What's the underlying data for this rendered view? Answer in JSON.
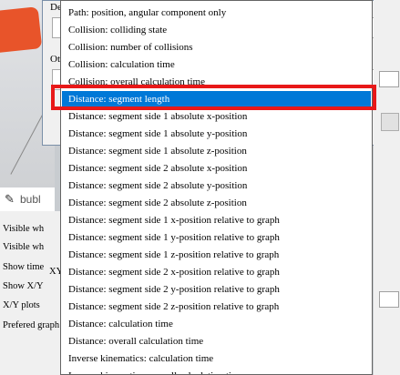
{
  "background": {
    "dialog_label_top": "De",
    "dialog_label_mid": "Ot",
    "bubble_title": "bubl",
    "props_rows": [
      "Visible wh",
      "Visible wh",
      "Show time",
      "Show X/Y",
      "X/Y plots",
      "Prefered graph"
    ],
    "xy_hint": "XY"
  },
  "dropdown": {
    "items": [
      "Path: position, angular component only",
      "Collision: colliding state",
      "Collision: number of collisions",
      "Collision: calculation time",
      "Collision: overall calculation time",
      "Distance: segment length",
      "Distance: segment side 1 absolute x-position",
      "Distance: segment side 1 absolute y-position",
      "Distance: segment side 1 absolute z-position",
      "Distance: segment side 2 absolute x-position",
      "Distance: segment side 2 absolute y-position",
      "Distance: segment side 2 absolute z-position",
      "Distance: segment side 1 x-position relative to graph",
      "Distance: segment side 1 y-position relative to graph",
      "Distance: segment side 1 z-position relative to graph",
      "Distance: segment side 2 x-position relative to graph",
      "Distance: segment side 2 y-position relative to graph",
      "Distance: segment side 2 z-position relative to graph",
      "Distance: calculation time",
      "Distance: overall calculation time",
      "Inverse kinematics: calculation time",
      "Inverse kinematics: overall calculation time"
    ],
    "selected_index": 5
  },
  "colors": {
    "selection": "#0078d7",
    "annotation_box": "#e81818"
  }
}
